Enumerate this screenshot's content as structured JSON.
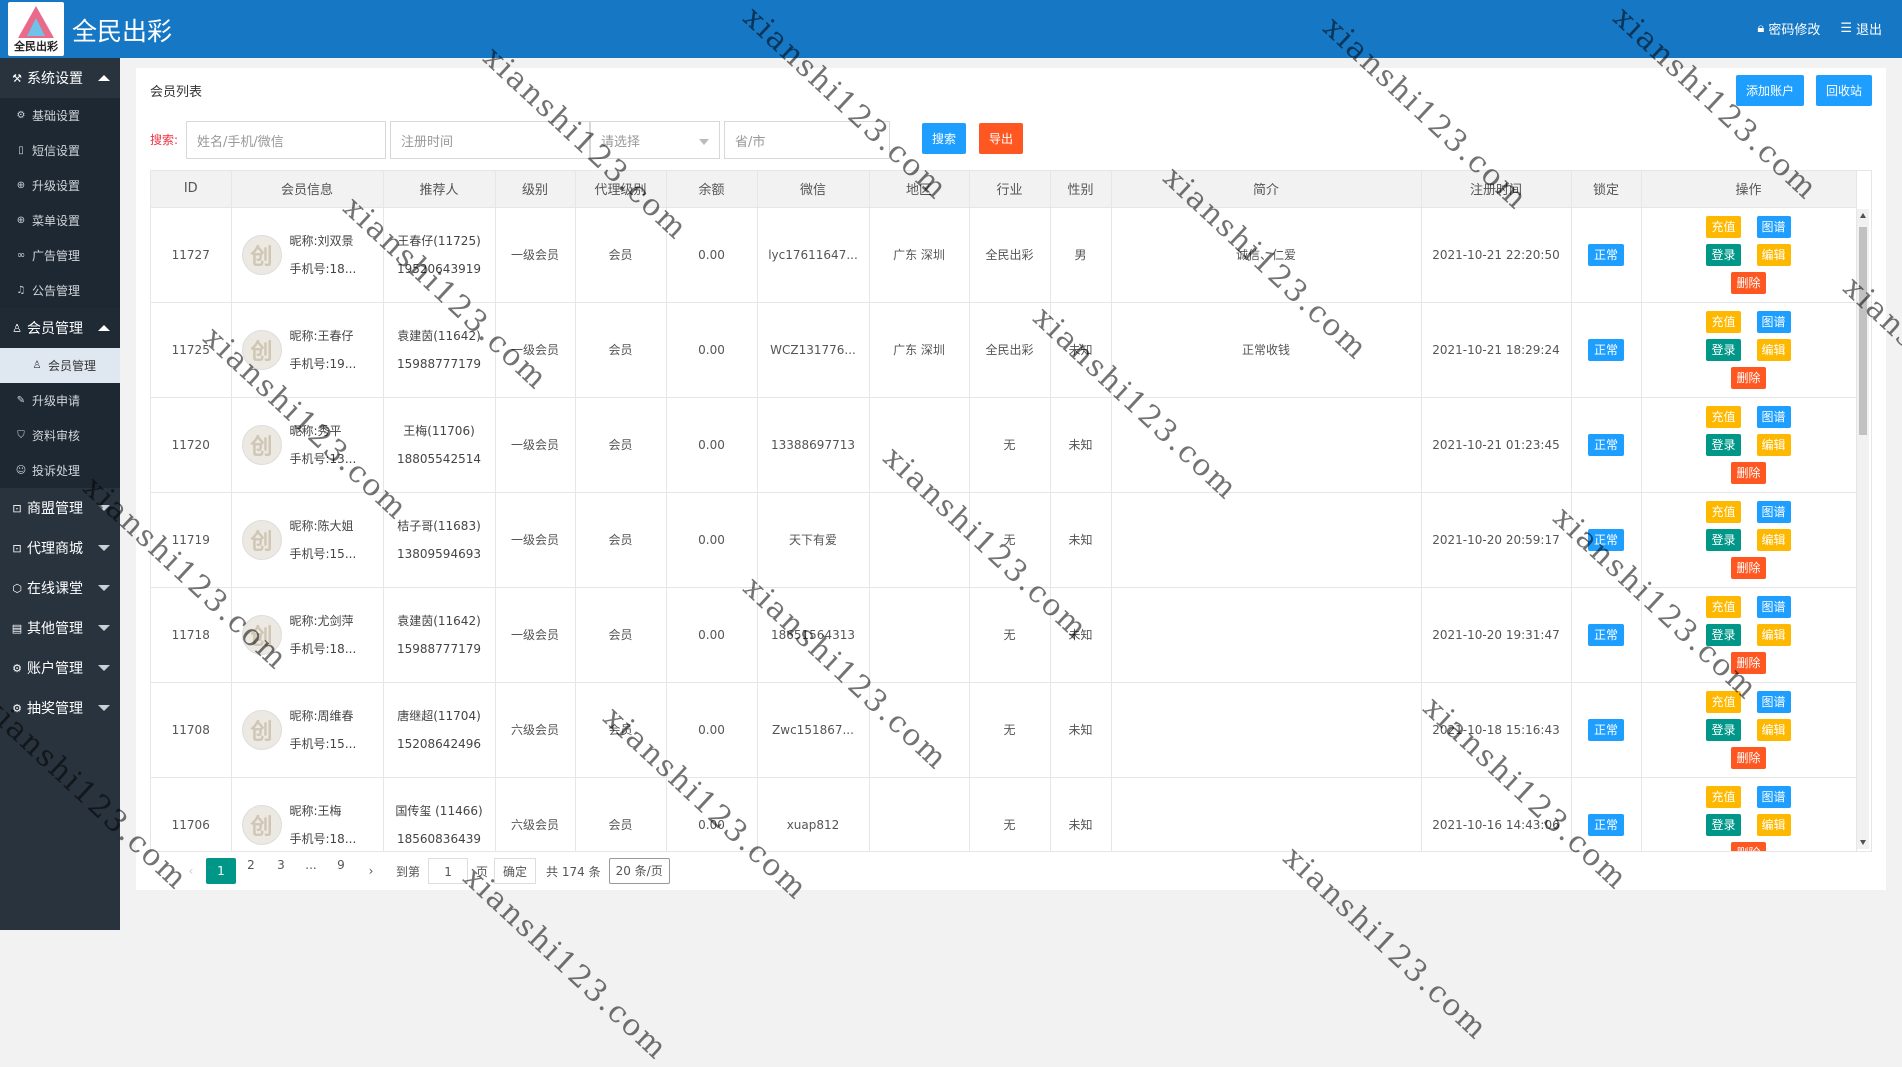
{
  "header": {
    "app_name": "全民出彩",
    "logo_text": "全民出彩",
    "change_pwd": "密码修改",
    "logout": "退出"
  },
  "sidebar": {
    "groups": [
      {
        "label": "系统设置",
        "icon": "wrench-icon",
        "expanded": true,
        "items": [
          {
            "label": "基础设置",
            "icon": "gear-icon"
          },
          {
            "label": "短信设置",
            "icon": "phone-icon"
          },
          {
            "label": "升级设置",
            "icon": "upgrade-icon"
          },
          {
            "label": "菜单设置",
            "icon": "upgrade-icon"
          },
          {
            "label": "广告管理",
            "icon": "link-icon"
          },
          {
            "label": "公告管理",
            "icon": "bell-icon"
          }
        ]
      },
      {
        "label": "会员管理",
        "icon": "user-icon",
        "expanded": true,
        "active": true,
        "items": [
          {
            "label": "会员管理",
            "icon": "user-icon",
            "selected": true
          },
          {
            "label": "升级申请",
            "icon": "edit-icon"
          },
          {
            "label": "资料审核",
            "icon": "shield-icon"
          },
          {
            "label": "投诉处理",
            "icon": "smile-icon"
          }
        ]
      },
      {
        "label": "商盟管理",
        "icon": "cart-icon"
      },
      {
        "label": "代理商城",
        "icon": "cart-icon"
      },
      {
        "label": "在线课堂",
        "icon": "box-icon"
      },
      {
        "label": "其他管理",
        "icon": "doc-icon"
      },
      {
        "label": "账户管理",
        "icon": "gear-icon"
      },
      {
        "label": "抽奖管理",
        "icon": "gear-icon"
      }
    ]
  },
  "page": {
    "title": "会员列表",
    "add_btn": "添加账户",
    "recycle_btn": "回收站"
  },
  "search": {
    "label": "搜索:",
    "name_placeholder": "姓名/手机/微信",
    "date_placeholder": "注册时间",
    "select_placeholder": "请选择",
    "city_placeholder": "省/市",
    "search_btn": "搜索",
    "export_btn": "导出"
  },
  "table": {
    "headers": [
      "ID",
      "会员信息",
      "推荐人",
      "级别",
      "代理级别",
      "余额",
      "微信",
      "地区",
      "行业",
      "性别",
      "简介",
      "注册时间",
      "锁定",
      "操作"
    ],
    "nick_prefix": "昵称:",
    "phone_prefix": "手机号:",
    "op_labels": {
      "recharge": "充值",
      "tree": "图谱",
      "login": "登录",
      "edit": "编辑",
      "delete": "删除"
    },
    "rows": [
      {
        "id": "11727",
        "nick": "刘双景",
        "phone": "18...",
        "ref_name": "王春仔(11725)",
        "ref_phone": "19520643919",
        "level": "一级会员",
        "agent": "会员",
        "balance": "0.00",
        "wechat": "lyc17611647...",
        "region": "广东 深圳",
        "industry": "全民出彩",
        "gender": "男",
        "intro": "诚信、仁爱",
        "reg_time": "2021-10-21 22:20:50",
        "lock": "正常"
      },
      {
        "id": "11725",
        "nick": "王春仔",
        "phone": "19...",
        "ref_name": "袁建茵(11642)",
        "ref_phone": "15988777179",
        "level": "一级会员",
        "agent": "会员",
        "balance": "0.00",
        "wechat": "WCZ131776...",
        "region": "广东 深圳",
        "industry": "全民出彩",
        "gender": "未知",
        "intro": "正常收钱",
        "reg_time": "2021-10-21 18:29:24",
        "lock": "正常"
      },
      {
        "id": "11720",
        "nick": "秀平",
        "phone": "13...",
        "ref_name": "王梅(11706)",
        "ref_phone": "18805542514",
        "level": "一级会员",
        "agent": "会员",
        "balance": "0.00",
        "wechat": "13388697713",
        "region": "",
        "industry": "无",
        "gender": "未知",
        "intro": "",
        "reg_time": "2021-10-21 01:23:45",
        "lock": "正常"
      },
      {
        "id": "11719",
        "nick": "陈大姐",
        "phone": "15...",
        "ref_name": "桔子哥(11683)",
        "ref_phone": "13809594693",
        "level": "一级会员",
        "agent": "会员",
        "balance": "0.00",
        "wechat": "天下有爱",
        "region": "",
        "industry": "无",
        "gender": "未知",
        "intro": "",
        "reg_time": "2021-10-20 20:59:17",
        "lock": "正常"
      },
      {
        "id": "11718",
        "nick": "尤剑萍",
        "phone": "18...",
        "ref_name": "袁建茵(11642)",
        "ref_phone": "15988777179",
        "level": "一级会员",
        "agent": "会员",
        "balance": "0.00",
        "wechat": "18651564313",
        "region": "",
        "industry": "无",
        "gender": "未知",
        "intro": "",
        "reg_time": "2021-10-20 19:31:47",
        "lock": "正常"
      },
      {
        "id": "11708",
        "nick": "周维春",
        "phone": "15...",
        "ref_name": "唐继超(11704)",
        "ref_phone": "15208642496",
        "level": "六级会员",
        "agent": "会员",
        "balance": "0.00",
        "wechat": "Zwc151867...",
        "region": "",
        "industry": "无",
        "gender": "未知",
        "intro": "",
        "reg_time": "2021-10-18 15:16:43",
        "lock": "正常"
      },
      {
        "id": "11706",
        "nick": "王梅",
        "phone": "18...",
        "ref_name": "国传玺 (11466)",
        "ref_phone": "18560836439",
        "level": "六级会员",
        "agent": "会员",
        "balance": "0.00",
        "wechat": "xuap812",
        "region": "",
        "industry": "无",
        "gender": "未知",
        "intro": "",
        "reg_time": "2021-10-16 14:43:06",
        "lock": "正常"
      }
    ]
  },
  "pagination": {
    "pages": [
      "1",
      "2",
      "3",
      "...",
      "9"
    ],
    "goto_label": "到第",
    "goto_value": "1",
    "page_unit": "页",
    "confirm": "确定",
    "total": "共 174 条",
    "page_size": "20 条/页"
  },
  "watermark": {
    "text": "xianshi123.com"
  },
  "colors": {
    "header": "#1677c5",
    "sidebar": "#28333e",
    "primary": "#1e9fff",
    "danger": "#ff5722",
    "warn": "#ffb800",
    "green": "#009688"
  }
}
